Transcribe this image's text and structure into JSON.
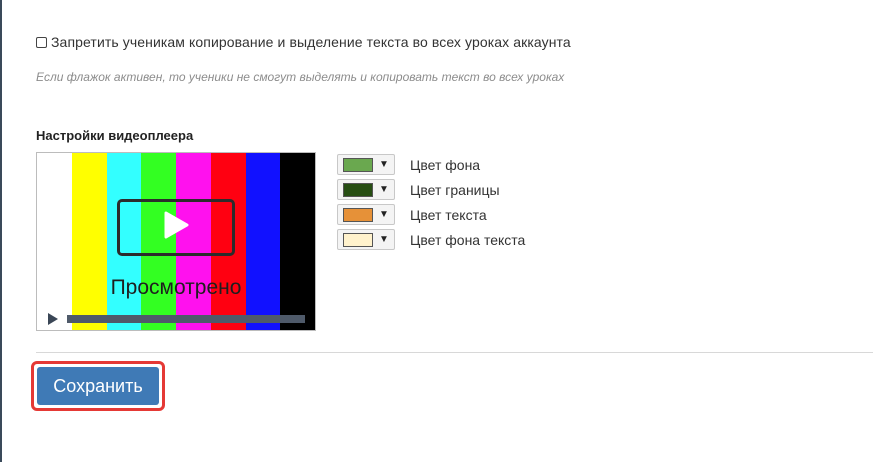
{
  "copy_protection": {
    "checkbox_label": "Запретить ученикам копирование и выделение текста во всех уроках аккаунта",
    "checked": false,
    "hint": "Если флажок активен, то ученики не смогут выделять и копировать текст во всех уроках"
  },
  "video_player": {
    "section_title": "Настройки видеоплеера",
    "preview": {
      "overlay_text": "Просмотрено",
      "bar_colors": [
        "#ffffff",
        "#ffff00",
        "#33ffff",
        "#33ff22",
        "#ff11ee",
        "#ff0011",
        "#1111ff",
        "#000000"
      ]
    },
    "colors": [
      {
        "label": "Цвет фона",
        "value": "#6aa84f"
      },
      {
        "label": "Цвет границы",
        "value": "#274e13"
      },
      {
        "label": "Цвет текста",
        "value": "#e69138"
      },
      {
        "label": "Цвет фона текста",
        "value": "#fff2cc"
      }
    ]
  },
  "actions": {
    "save_label": "Сохранить",
    "save_color": "#3f7ab6",
    "highlight_color": "#e53935"
  }
}
